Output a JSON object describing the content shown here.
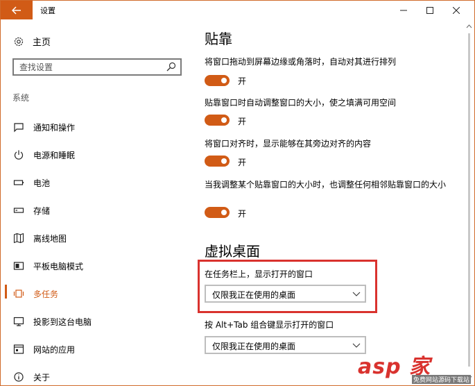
{
  "window": {
    "title": "设置",
    "accent_color": "#d15b16"
  },
  "sidebar": {
    "home_label": "主页",
    "search_placeholder": "查找设置",
    "section_label": "系统",
    "items": [
      {
        "label": "通知和操作",
        "icon": "notification-icon"
      },
      {
        "label": "电源和睡眠",
        "icon": "power-icon"
      },
      {
        "label": "电池",
        "icon": "battery-icon"
      },
      {
        "label": "存储",
        "icon": "storage-icon"
      },
      {
        "label": "离线地图",
        "icon": "map-icon"
      },
      {
        "label": "平板电脑模式",
        "icon": "tablet-icon"
      },
      {
        "label": "多任务",
        "icon": "multitasking-icon",
        "active": true
      },
      {
        "label": "投影到这台电脑",
        "icon": "project-icon"
      },
      {
        "label": "网站的应用",
        "icon": "web-apps-icon"
      },
      {
        "label": "关于",
        "icon": "info-icon"
      }
    ]
  },
  "main": {
    "snap_heading": "贴靠",
    "snap_settings": [
      {
        "label": "将窗口拖动到屏幕边缘或角落时，自动对其进行排列",
        "state": "开",
        "on": true
      },
      {
        "label": "贴靠窗口时自动调整窗口的大小，使之填满可用空间",
        "state": "开",
        "on": true
      },
      {
        "label": "将窗口对齐时，显示能够在其旁边对齐的内容",
        "state": "开",
        "on": true
      },
      {
        "label": "当我调整某个贴靠窗口的大小时，也调整任何相邻贴靠窗口的大小",
        "state": "开",
        "on": true
      }
    ],
    "virtual_desktops_heading": "虚拟桌面",
    "taskbar_label": "在任务栏上，显示打开的窗口",
    "taskbar_value": "仅限我正在使用的桌面",
    "alttab_label": "按 Alt+Tab 组合键显示打开的窗口",
    "alttab_value": "仅限我正在使用的桌面"
  },
  "watermark": {
    "logo": "asp 家",
    "sub": "免费网站源码下载站"
  }
}
